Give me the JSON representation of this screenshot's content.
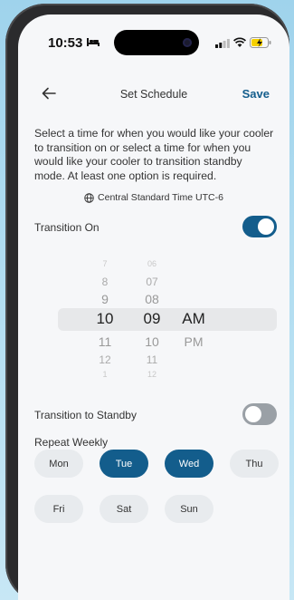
{
  "status_bar": {
    "time": "10:53"
  },
  "nav": {
    "title": "Set Schedule",
    "save_label": "Save"
  },
  "description": "Select a time for when you would like your cooler to transition on or select a time for when you would like your cooler to transition standby mode. At least one option is required.",
  "timezone": "Central Standard Time UTC-6",
  "transition_on": {
    "label": "Transition On",
    "enabled": true
  },
  "picker": {
    "hours": [
      "7",
      "8",
      "9",
      "10",
      "11",
      "12",
      "1"
    ],
    "minutes": [
      "06",
      "07",
      "08",
      "09",
      "10",
      "11",
      "12"
    ],
    "periods": [
      "AM",
      "PM"
    ],
    "selected": {
      "hour": "10",
      "minute": "09",
      "period": "AM"
    }
  },
  "transition_standby": {
    "label": "Transition to Standby",
    "enabled": false
  },
  "repeat": {
    "label": "Repeat Weekly",
    "days": [
      {
        "label": "Mon",
        "selected": false
      },
      {
        "label": "Tue",
        "selected": true
      },
      {
        "label": "Wed",
        "selected": true
      },
      {
        "label": "Thu",
        "selected": false
      },
      {
        "label": "Fri",
        "selected": false
      },
      {
        "label": "Sat",
        "selected": false
      },
      {
        "label": "Sun",
        "selected": false
      }
    ]
  },
  "colors": {
    "accent": "#135d8c",
    "toggle_off": "#9aa0a6",
    "chip": "#e8ebee"
  }
}
